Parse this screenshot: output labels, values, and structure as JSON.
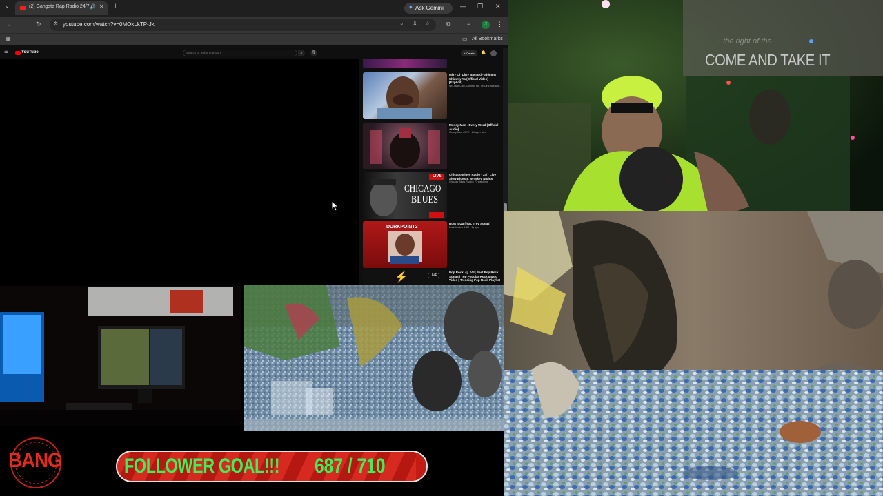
{
  "browser": {
    "tab_title": "(2) Gangsta Rap Radio 24/7",
    "gemini_label": "Ask Gemini",
    "url": "youtube.com/watch?v=0MOkLkTP-Jk",
    "profile_initial": "J",
    "bookmarks_label": "All Bookmarks"
  },
  "youtube": {
    "logo_text": "YouTube",
    "search_placeholder": "Search or ask a question",
    "create_label": "+ Create",
    "recommendations": [
      {
        "title": "Mix - Ol' Dirty Bastard - Shimmy Shimmy Ya (Official Video) [Explicit]",
        "sub": " Wu-Tang Clan, Cypress Hill, Ol' Dirty Bastard..."
      },
      {
        "title": "Money Man - Every Word (Official Audio)",
        "sub": "Money Man  •  1.7K · 6d ago  •  New"
      },
      {
        "title": "Chicago Blues Radio - 24/7 Live Slow Blues & Whiskey Nights",
        "sub": "Chicago Blues Radio  •  77 watching"
      },
      {
        "title": "Bust It Up (feat. Trey Songz)",
        "sub": "Durk Music  •  6.8M · 1y ago"
      },
      {
        "title": "Pop Rock ♪ [LIVE] Best Pop Rock Songs | Top Popular Rock Music Video | Trending Pop Rock Playlist",
        "sub": ""
      }
    ],
    "thumb_labels": {
      "live": "LIVE",
      "chicago": "CHICAGO",
      "blues": "BLUES",
      "durk": "DURKPOINT2",
      "live_badge": "LIVE"
    }
  },
  "webcam": {
    "sign_main": "COME AND TAKE IT",
    "sign_sub": "...the right of the"
  },
  "overlay": {
    "bang_text": "BANG",
    "goal_label": "FOLLOWER GOAL!!!",
    "goal_count": "687 / 710",
    "goal_current": 687,
    "goal_target": 710
  },
  "colors": {
    "goal_text": "#3df05a",
    "goal_bar": "#c31c14",
    "youtube_red": "#ff0000"
  }
}
